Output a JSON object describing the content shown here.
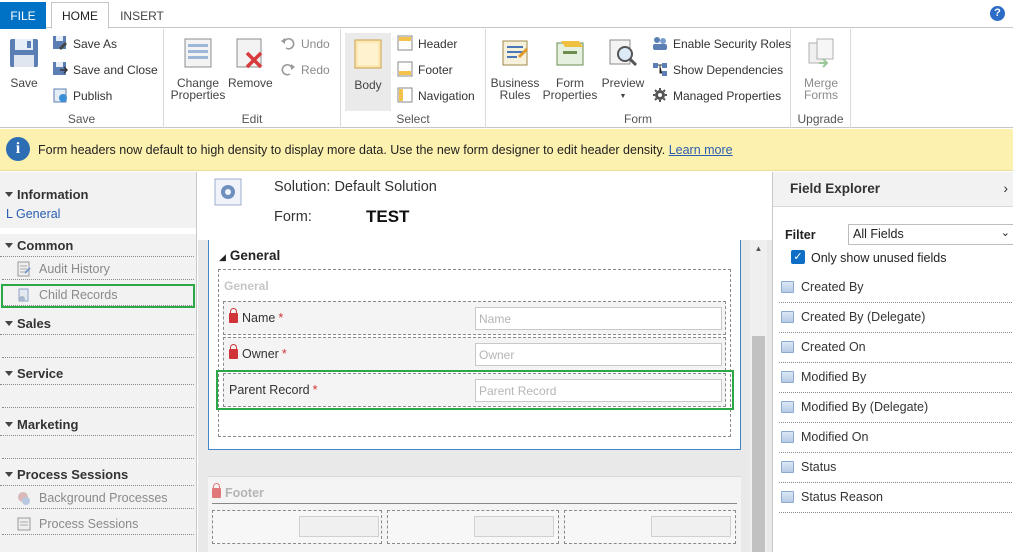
{
  "tabs": {
    "file": "FILE",
    "home": "HOME",
    "insert": "INSERT"
  },
  "help_icon": "?",
  "ribbon": {
    "save": {
      "save": "Save",
      "save_as": "Save As",
      "save_and_close": "Save and Close",
      "publish": "Publish",
      "label": "Save"
    },
    "edit": {
      "change_properties": "Change Properties",
      "remove": "Remove",
      "undo": "Undo",
      "redo": "Redo",
      "label": "Edit"
    },
    "select": {
      "body": "Body",
      "header": "Header",
      "footer": "Footer",
      "navigation": "Navigation",
      "label": "Select"
    },
    "form": {
      "business_rules": "Business Rules",
      "form_properties": "Form Properties",
      "preview": "Preview",
      "enable_security_roles": "Enable Security Roles",
      "show_dependencies": "Show Dependencies",
      "managed_properties": "Managed Properties",
      "label": "Form"
    },
    "upgrade": {
      "merge_forms": "Merge Forms",
      "label": "Upgrade"
    }
  },
  "infobar": {
    "message": "Form headers now default to high density to display more data. Use the new form designer to edit header density.",
    "link": "Learn more"
  },
  "leftnav": {
    "information": {
      "title": "Information",
      "item": "General"
    },
    "common": {
      "title": "Common",
      "items": [
        "Audit History",
        "Child Records"
      ]
    },
    "sales": "Sales",
    "service": "Service",
    "marketing": "Marketing",
    "process_sessions": {
      "title": "Process Sessions",
      "items": [
        "Background Processes",
        "Process Sessions"
      ]
    }
  },
  "header": {
    "solution": "Solution: Default Solution",
    "form_label": "Form:",
    "form_name": "TEST"
  },
  "form": {
    "tab_title": "General",
    "section_label": "General",
    "fields": [
      {
        "label": "Name",
        "placeholder": "Name",
        "required": "*"
      },
      {
        "label": "Owner",
        "placeholder": "Owner",
        "required": "*"
      },
      {
        "label": "Parent Record",
        "placeholder": "Parent Record",
        "required": "*"
      }
    ],
    "footer_title": "Footer"
  },
  "explorer": {
    "title": "Field Explorer",
    "filter_label": "Filter",
    "filter_value": "All Fields",
    "unused_label": "Only show unused fields",
    "unused_checked": true,
    "fields": [
      "Created By",
      "Created By (Delegate)",
      "Created On",
      "Modified By",
      "Modified By (Delegate)",
      "Modified On",
      "Status",
      "Status Reason"
    ]
  },
  "colors": {
    "accent": "#0072c6",
    "highlight_border": "#2aa845",
    "infobar_bg": "#fdf1b0",
    "required": "#d13438"
  }
}
